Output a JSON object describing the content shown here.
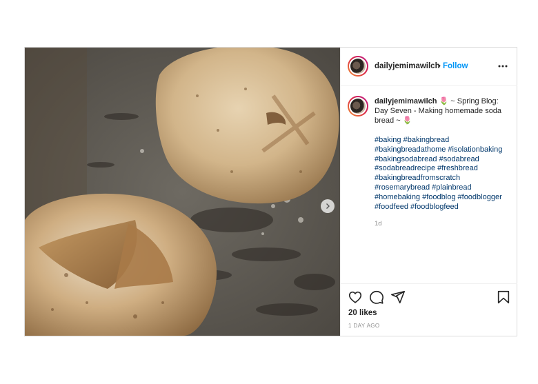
{
  "post": {
    "username": "dailyjemimawilch",
    "separator": "•",
    "follow_label": "Follow",
    "caption": {
      "username": "dailyjemimawilch",
      "emoji": "🌷",
      "text_head": " ~ Spring Blog: Day Seven - Making homemade soda bread ~ ",
      "emoji_end": "🌷"
    },
    "hashtag_lines": [
      [
        "#baking",
        "#bakingbread"
      ],
      [
        "#bakingbreadathome",
        "#isolationbaking"
      ],
      [
        "#bakingsodabread",
        "#sodabread"
      ],
      [
        "#sodabreadrecipe",
        "#freshbread"
      ],
      [
        "#bakingbreadfromscratch"
      ],
      [
        "#rosemarybread",
        "#plainbread"
      ],
      [
        "#homebaking",
        "#foodblog",
        "#foodblogger"
      ],
      [
        "#foodfeed",
        "#foodblogfeed"
      ]
    ],
    "comment_age": "1d",
    "likes": "20 likes",
    "timestamp": "1 DAY AGO"
  },
  "icons": {
    "more": "more-options-icon",
    "like": "heart-icon",
    "comment": "comment-icon",
    "share": "paper-plane-icon",
    "save": "bookmark-icon",
    "next": "chevron-right-icon"
  },
  "colors": {
    "accent": "#0095f6",
    "hashtag": "#00376b",
    "muted": "#8e8e8e",
    "text": "#262626",
    "border": "#dbdbdb"
  }
}
